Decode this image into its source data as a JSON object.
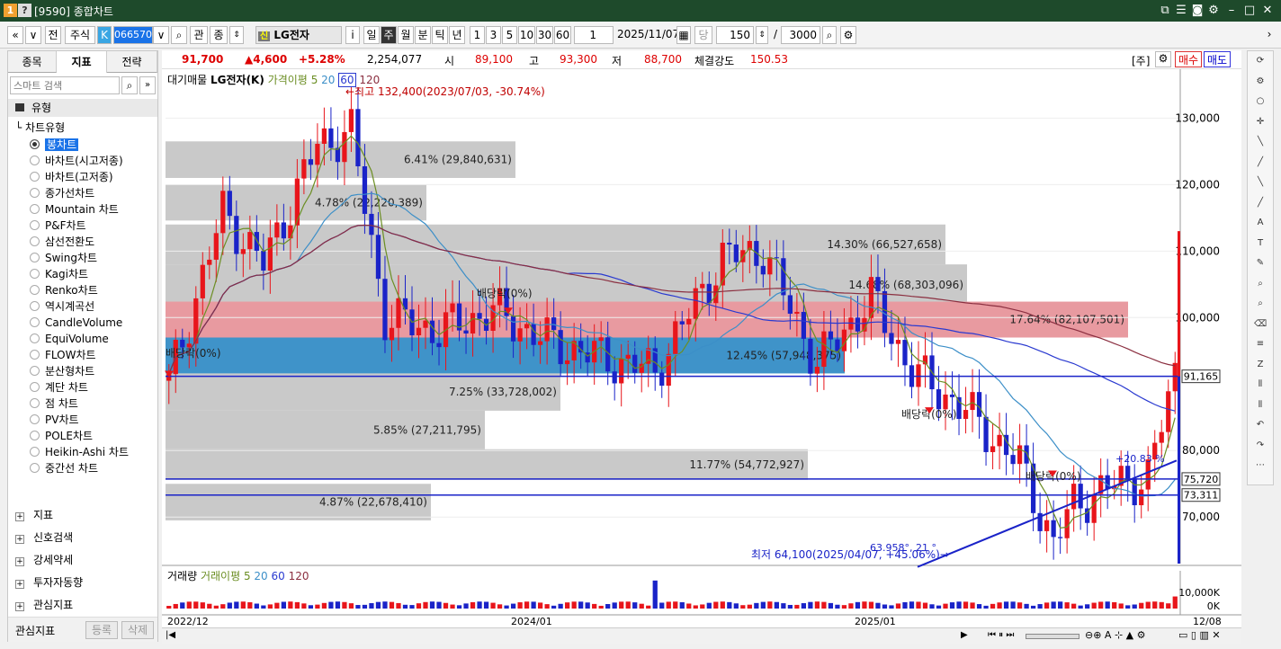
{
  "titlebar": {
    "code": "[9590]",
    "title": "종합차트"
  },
  "toolbar": {
    "market": "주식",
    "symbol_code": "066570",
    "symbol_name": "LG전자",
    "buttons": [
      "관",
      "종"
    ],
    "periods": [
      "일",
      "주",
      "월",
      "분",
      "틱",
      "년"
    ],
    "active_period": "주",
    "intervals": [
      "1",
      "3",
      "5",
      "10",
      "30",
      "60"
    ],
    "count_select": "1",
    "date": "2025/11/07",
    "unit_label": "당",
    "bars": "150",
    "total": "3000"
  },
  "left": {
    "tabs": [
      "종목",
      "지표",
      "전략"
    ],
    "active_tab": "지표",
    "search_placeholder": "스마트 검색",
    "section_title": "유형",
    "tree_title": "차트유형",
    "chart_types": [
      "봉차트",
      "바차트(시고저종)",
      "바차트(고저종)",
      "종가선차트",
      "Mountain 차트",
      "P&F차트",
      "삼선전환도",
      "Swing차트",
      "Kagi차트",
      "Renko차트",
      "역시계곡선",
      "CandleVolume",
      "EquiVolume",
      "FLOW차트",
      "분산형차트",
      "계단 차트",
      "점 차트",
      "PV차트",
      "POLE차트",
      "Heikin-Ashi 차트",
      "중간선 차트"
    ],
    "selected_type": "봉차트",
    "sections": [
      "지표",
      "신호검색",
      "강세약세",
      "투자자동향",
      "관심지표"
    ],
    "bottom_label": "관심지표",
    "register": "등록",
    "delete": "삭제"
  },
  "infobar": {
    "price": "91,700",
    "change": "▲4,600",
    "change_pct": "+5.28%",
    "volume": "2,254,077",
    "open_label": "시",
    "open": "89,100",
    "high_label": "고",
    "high": "93,300",
    "low_label": "저",
    "low": "88,700",
    "strength_label": "체결강도",
    "strength": "150.53",
    "order_label": "[주]",
    "buy": "매수",
    "sell": "매도"
  },
  "chart": {
    "legend_prefix": "대기매물",
    "legend_name": "LG전자(K)",
    "ma_label": "가격이평",
    "ma_periods": [
      "5",
      "20",
      "60",
      "120"
    ],
    "price_axis": [
      "130,000",
      "120,000",
      "110,000",
      "100,000",
      "80,000",
      "70,000"
    ],
    "price_axis_values": [
      130000,
      120000,
      110000,
      100000,
      80000,
      70000
    ],
    "current_price_tag": "91,165",
    "level_tags": [
      "75,720",
      "73,311"
    ],
    "high_note": "←최고 132,400(2023/07/03, -30.74%)",
    "low_note": "최저 64,100(2025/04/07, +45.06%)→",
    "trend_note": "63.958°, 21 °",
    "trend_right": "+20.83 %",
    "dividend_label": "배당락(0%)",
    "volume_profile": [
      {
        "label": "6.41% (29,840,631)",
        "pct": 6.41
      },
      {
        "label": "4.78% (22,220,389)",
        "pct": 4.78
      },
      {
        "label": "14.30% (66,527,658)",
        "pct": 14.3
      },
      {
        "label": "14.68% (68,303,096)",
        "pct": 14.68
      },
      {
        "label": "17.64% (82,107,501)",
        "pct": 17.64
      },
      {
        "label": "12.45% (57,948,375)",
        "pct": 12.45
      },
      {
        "label": "7.25% (33,728,002)",
        "pct": 7.25
      },
      {
        "label": "5.85% (27,211,795)",
        "pct": 5.85
      },
      {
        "label": "11.77% (54,772,927)",
        "pct": 11.77
      },
      {
        "label": "4.87% (22,678,410)",
        "pct": 4.87
      }
    ],
    "vol_legend": "거래량",
    "vol_ma_label": "거래이평",
    "vol_ma": [
      "5",
      "20",
      "60",
      "120"
    ],
    "vol_axis": [
      "10,000K",
      "0K"
    ],
    "dates": [
      "2022/12",
      "2024/01",
      "2025/01",
      "12/08"
    ]
  },
  "colors": {
    "up": "#e8151b",
    "down": "#1a23c8",
    "ma5": "#6b8e23",
    "ma20": "#3c8fc8",
    "ma60": "#2a3ad0",
    "ma120": "#8b2f40",
    "profile": "#c9c9c9",
    "profile_hot": "#e89aa0",
    "profile_cur": "#3f93c9"
  }
}
